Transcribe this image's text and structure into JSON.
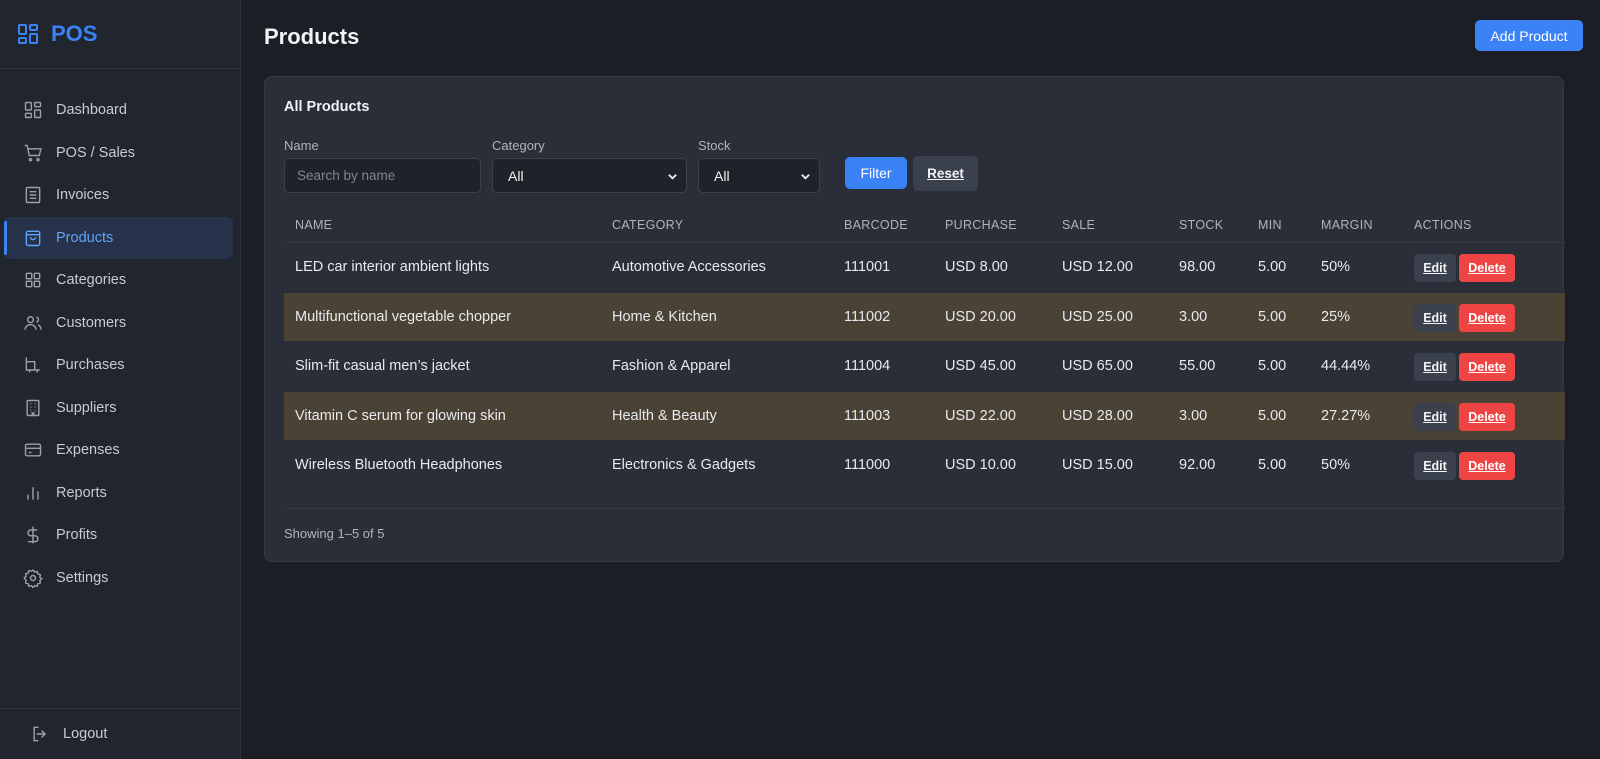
{
  "app": {
    "brand": "POS"
  },
  "sidebar": {
    "items": [
      {
        "label": "Dashboard",
        "icon": "dashboard-icon"
      },
      {
        "label": "POS / Sales",
        "icon": "cart-icon"
      },
      {
        "label": "Invoices",
        "icon": "invoice-icon"
      },
      {
        "label": "Products",
        "icon": "bag-icon",
        "active": true
      },
      {
        "label": "Categories",
        "icon": "grid-icon"
      },
      {
        "label": "Customers",
        "icon": "users-icon"
      },
      {
        "label": "Purchases",
        "icon": "purchase-icon"
      },
      {
        "label": "Suppliers",
        "icon": "building-icon"
      },
      {
        "label": "Expenses",
        "icon": "card-icon"
      },
      {
        "label": "Reports",
        "icon": "bar-chart-icon"
      },
      {
        "label": "Profits",
        "icon": "dollar-icon"
      },
      {
        "label": "Settings",
        "icon": "gear-icon"
      }
    ],
    "logout": "Logout"
  },
  "header": {
    "title": "Products",
    "add_label": "Add Product"
  },
  "card": {
    "title": "All Products",
    "filters": {
      "name_label": "Name",
      "name_placeholder": "Search by name",
      "category_label": "Category",
      "category_value": "All",
      "stock_label": "Stock",
      "stock_value": "All",
      "filter_label": "Filter",
      "reset_label": "Reset"
    },
    "columns": [
      "NAME",
      "CATEGORY",
      "BARCODE",
      "PURCHASE",
      "SALE",
      "STOCK",
      "MIN",
      "MARGIN",
      "ACTIONS"
    ],
    "rows": [
      {
        "name": "LED car interior ambient lights",
        "category": "Automotive Accessories",
        "barcode": "111001",
        "purchase": "USD 8.00",
        "sale": "USD 12.00",
        "stock": "98.00",
        "min": "5.00",
        "margin": "50%",
        "low_stock": false
      },
      {
        "name": "Multifunctional vegetable chopper",
        "category": "Home & Kitchen",
        "barcode": "111002",
        "purchase": "USD 20.00",
        "sale": "USD 25.00",
        "stock": "3.00",
        "min": "5.00",
        "margin": "25%",
        "low_stock": true
      },
      {
        "name": "Slim-fit casual men’s jacket",
        "category": "Fashion & Apparel",
        "barcode": "111004",
        "purchase": "USD 45.00",
        "sale": "USD 65.00",
        "stock": "55.00",
        "min": "5.00",
        "margin": "44.44%",
        "low_stock": false
      },
      {
        "name": "Vitamin C serum for glowing skin",
        "category": "Health & Beauty",
        "barcode": "111003",
        "purchase": "USD 22.00",
        "sale": "USD 28.00",
        "stock": "3.00",
        "min": "5.00",
        "margin": "27.27%",
        "low_stock": true
      },
      {
        "name": "Wireless Bluetooth Headphones",
        "category": "Electronics & Gadgets",
        "barcode": "111000",
        "purchase": "USD 10.00",
        "sale": "USD 15.00",
        "stock": "92.00",
        "min": "5.00",
        "margin": "50%",
        "low_stock": false
      }
    ],
    "edit_label": "Edit",
    "delete_label": "Delete",
    "showing": "Showing 1–5 of 5"
  },
  "colors": {
    "accent": "#3b82f6",
    "danger": "#ef4444",
    "low_stock_row": "#4a4335"
  }
}
